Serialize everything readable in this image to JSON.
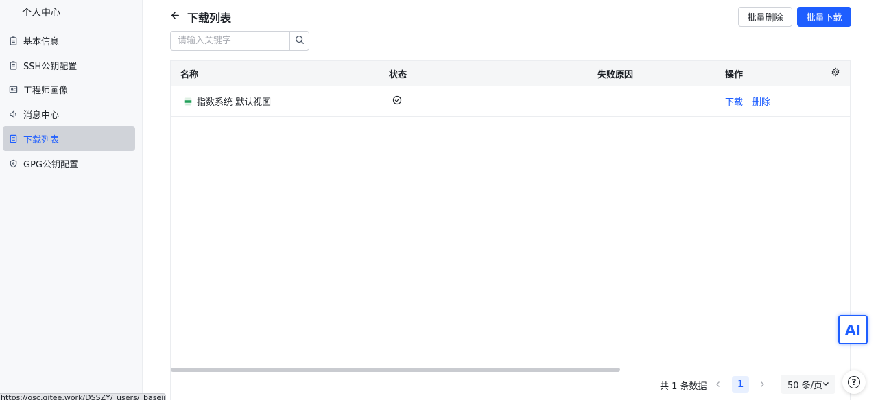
{
  "sidebar": {
    "title": "个人中心",
    "items": [
      {
        "label": "基本信息",
        "icon": "clipboard-icon"
      },
      {
        "label": "SSH公钥配置",
        "icon": "clipboard-icon"
      },
      {
        "label": "工程师画像",
        "icon": "portrait-icon"
      },
      {
        "label": "消息中心",
        "icon": "speaker-icon"
      },
      {
        "label": "下载列表",
        "icon": "document-list-icon",
        "active": true
      },
      {
        "label": "GPG公钥配置",
        "icon": "shield-icon"
      }
    ]
  },
  "header": {
    "title": "下载列表",
    "batch_delete": "批量删除",
    "batch_download": "批量下载"
  },
  "search": {
    "placeholder": "请输入关键字",
    "value": ""
  },
  "table": {
    "columns": [
      "名称",
      "状态",
      "失败原因",
      "操作"
    ],
    "rows": [
      {
        "name": "指数系统 默认视图",
        "status": "success",
        "reason": "",
        "actions": [
          "下载",
          "删除"
        ]
      }
    ]
  },
  "pagination": {
    "total_text": "共 1 条数据",
    "current_page": "1",
    "page_size": "50 条/页"
  },
  "floating": {
    "ai_label": "AI",
    "help_label": "?"
  },
  "status_url": "https://osc.gitee.work/DSSZY/_users/_baseinfo",
  "colors": {
    "accent": "#1e5eff",
    "sidebar_bg": "#f7f8fa",
    "active_item_bg": "#d0d3d9"
  }
}
